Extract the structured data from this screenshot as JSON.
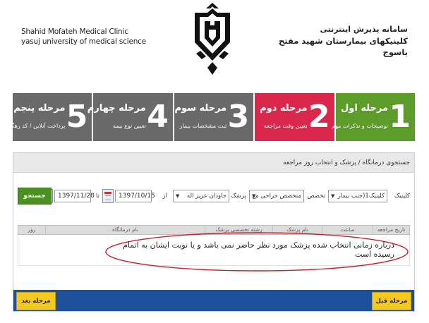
{
  "header": {
    "clinic_en_line1": "Shahid Mofateh Medical Clinic",
    "clinic_en_line2": "yasuj university of medical science",
    "system_title_fa": "سامانه پذیرش اینترنتی",
    "clinic_name_fa": "کلینیکهای بیمارستان شهید مفتح یاسوج",
    "logo_icon": "university-emblem-icon"
  },
  "steps": [
    {
      "number": "1",
      "title": "مرحله اول",
      "desc": "توضیحات و تذکرات مهم",
      "color": "#5c9c2b"
    },
    {
      "number": "2",
      "title": "مرحله دوم",
      "desc": "تعیین وقت مراجعه",
      "color": "#d9284b"
    },
    {
      "number": "3",
      "title": "مرحله سوم",
      "desc": "ثبت مشخصات بیمار",
      "color": "#6a6a6a"
    },
    {
      "number": "4",
      "title": "مرحله چهارم",
      "desc": "تعیین نوع بیمه",
      "color": "#6a6a6a"
    },
    {
      "number": "5",
      "title": "مرحله پنجم",
      "desc": "پرداخت آنلاین / کد رهگیری",
      "color": "#6a6a6a"
    }
  ],
  "panel": {
    "breadcrumb": "جستجوی درمانگاه / پزشک و انتخاب روز مراجعه"
  },
  "filters": {
    "clinic_label": "کلینیک",
    "clinic_value": "کلینیک1(جنب بیمار",
    "specialty_label": "تخصص",
    "specialty_value": "متخصص جراحی مغ",
    "doctor_label": "پزشک",
    "doctor_value": "جاودان عزیز اله",
    "from_label": "از",
    "from_date": "1397/10/15",
    "to_label": "تا",
    "to_date": "1397/11/28",
    "search_button": "جستجو"
  },
  "table": {
    "columns": [
      "تاریخ مراجعه",
      "ساعت",
      "نام پزشک",
      "رشته تخصصی پزشک",
      "نام درمانگاه",
      "روز"
    ]
  },
  "message": "درباره زمانی انتخاب شده پزشک مورد نظر حاضر نمی باشد و یا نوبت ایشان به اتمام رسیده است",
  "footer": {
    "prev_button": "مرحله قبل",
    "next_button": "مرحله بعد",
    "bar_color": "#1d4f9a",
    "button_color": "#f5c81e"
  }
}
